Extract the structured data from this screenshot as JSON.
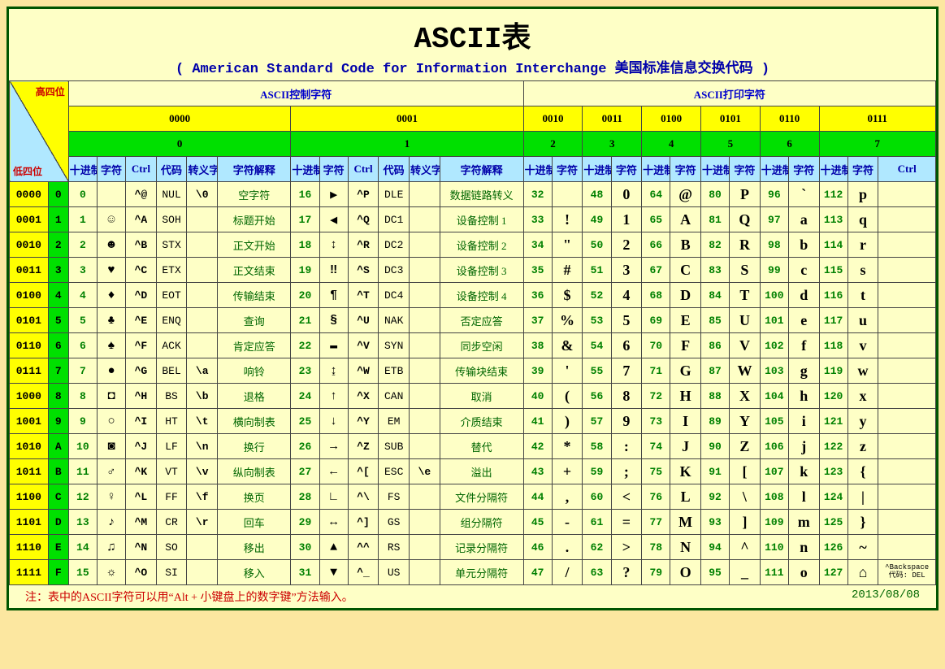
{
  "title": "ASCII表",
  "subtitle": "( American Standard Code for Information Interchange  美国标准信息交换代码 )",
  "diag": {
    "top": "高四位",
    "bottom": "低四位"
  },
  "section_headers": {
    "control": "ASCII控制字符",
    "print": "ASCII打印字符"
  },
  "high_bits": [
    "0000",
    "0001",
    "0010",
    "0011",
    "0100",
    "0101",
    "0110",
    "0111"
  ],
  "high_digits": [
    "0",
    "1",
    "2",
    "3",
    "4",
    "5",
    "6",
    "7"
  ],
  "col_labels": {
    "dec": "十进制",
    "char": "字符",
    "ctrl": "Ctrl",
    "code": "代码",
    "esc": "转义字符",
    "desc": "字符解释"
  },
  "low_bits": [
    "0000",
    "0001",
    "0010",
    "0011",
    "0100",
    "0101",
    "0110",
    "0111",
    "1000",
    "1001",
    "1010",
    "1011",
    "1100",
    "1101",
    "1110",
    "1111"
  ],
  "low_digits": [
    "0",
    "1",
    "2",
    "3",
    "4",
    "5",
    "6",
    "7",
    "8",
    "9",
    "A",
    "B",
    "C",
    "D",
    "E",
    "F"
  ],
  "rows": [
    {
      "b0": {
        "dec": "0",
        "sym": "",
        "ctrl": "^@",
        "code": "NUL",
        "esc": "\\0",
        "desc": "空字符"
      },
      "b1": {
        "dec": "16",
        "sym": "▶",
        "ctrl": "^P",
        "code": "DLE",
        "esc": "",
        "desc": "数据链路转义"
      },
      "p": [
        {
          "dec": "32",
          "ch": " "
        },
        {
          "dec": "48",
          "ch": "0"
        },
        {
          "dec": "64",
          "ch": "@"
        },
        {
          "dec": "80",
          "ch": "P"
        },
        {
          "dec": "96",
          "ch": "`"
        },
        {
          "dec": "112",
          "ch": "p"
        }
      ],
      "ctrl": ""
    },
    {
      "b0": {
        "dec": "1",
        "sym": "☺",
        "ctrl": "^A",
        "code": "SOH",
        "esc": "",
        "desc": "标题开始"
      },
      "b1": {
        "dec": "17",
        "sym": "◀",
        "ctrl": "^Q",
        "code": "DC1",
        "esc": "",
        "desc": "设备控制 1"
      },
      "p": [
        {
          "dec": "33",
          "ch": "!"
        },
        {
          "dec": "49",
          "ch": "1"
        },
        {
          "dec": "65",
          "ch": "A"
        },
        {
          "dec": "81",
          "ch": "Q"
        },
        {
          "dec": "97",
          "ch": "a"
        },
        {
          "dec": "113",
          "ch": "q"
        }
      ],
      "ctrl": ""
    },
    {
      "b0": {
        "dec": "2",
        "sym": "☻",
        "ctrl": "^B",
        "code": "STX",
        "esc": "",
        "desc": "正文开始"
      },
      "b1": {
        "dec": "18",
        "sym": "↕",
        "ctrl": "^R",
        "code": "DC2",
        "esc": "",
        "desc": "设备控制 2"
      },
      "p": [
        {
          "dec": "34",
          "ch": "\""
        },
        {
          "dec": "50",
          "ch": "2"
        },
        {
          "dec": "66",
          "ch": "B"
        },
        {
          "dec": "82",
          "ch": "R"
        },
        {
          "dec": "98",
          "ch": "b"
        },
        {
          "dec": "114",
          "ch": "r"
        }
      ],
      "ctrl": ""
    },
    {
      "b0": {
        "dec": "3",
        "sym": "♥",
        "ctrl": "^C",
        "code": "ETX",
        "esc": "",
        "desc": "正文结束"
      },
      "b1": {
        "dec": "19",
        "sym": "‼",
        "ctrl": "^S",
        "code": "DC3",
        "esc": "",
        "desc": "设备控制 3"
      },
      "p": [
        {
          "dec": "35",
          "ch": "#"
        },
        {
          "dec": "51",
          "ch": "3"
        },
        {
          "dec": "67",
          "ch": "C"
        },
        {
          "dec": "83",
          "ch": "S"
        },
        {
          "dec": "99",
          "ch": "c"
        },
        {
          "dec": "115",
          "ch": "s"
        }
      ],
      "ctrl": ""
    },
    {
      "b0": {
        "dec": "4",
        "sym": "♦",
        "ctrl": "^D",
        "code": "EOT",
        "esc": "",
        "desc": "传输结束"
      },
      "b1": {
        "dec": "20",
        "sym": "¶",
        "ctrl": "^T",
        "code": "DC4",
        "esc": "",
        "desc": "设备控制 4"
      },
      "p": [
        {
          "dec": "36",
          "ch": "$"
        },
        {
          "dec": "52",
          "ch": "4"
        },
        {
          "dec": "68",
          "ch": "D"
        },
        {
          "dec": "84",
          "ch": "T"
        },
        {
          "dec": "100",
          "ch": "d"
        },
        {
          "dec": "116",
          "ch": "t"
        }
      ],
      "ctrl": ""
    },
    {
      "b0": {
        "dec": "5",
        "sym": "♣",
        "ctrl": "^E",
        "code": "ENQ",
        "esc": "",
        "desc": "查询"
      },
      "b1": {
        "dec": "21",
        "sym": "§",
        "ctrl": "^U",
        "code": "NAK",
        "esc": "",
        "desc": "否定应答"
      },
      "p": [
        {
          "dec": "37",
          "ch": "%"
        },
        {
          "dec": "53",
          "ch": "5"
        },
        {
          "dec": "69",
          "ch": "E"
        },
        {
          "dec": "85",
          "ch": "U"
        },
        {
          "dec": "101",
          "ch": "e"
        },
        {
          "dec": "117",
          "ch": "u"
        }
      ],
      "ctrl": ""
    },
    {
      "b0": {
        "dec": "6",
        "sym": "♠",
        "ctrl": "^F",
        "code": "ACK",
        "esc": "",
        "desc": "肯定应答"
      },
      "b1": {
        "dec": "22",
        "sym": "▬",
        "ctrl": "^V",
        "code": "SYN",
        "esc": "",
        "desc": "同步空闲"
      },
      "p": [
        {
          "dec": "38",
          "ch": "&"
        },
        {
          "dec": "54",
          "ch": "6"
        },
        {
          "dec": "70",
          "ch": "F"
        },
        {
          "dec": "86",
          "ch": "V"
        },
        {
          "dec": "102",
          "ch": "f"
        },
        {
          "dec": "118",
          "ch": "v"
        }
      ],
      "ctrl": ""
    },
    {
      "b0": {
        "dec": "7",
        "sym": "●",
        "ctrl": "^G",
        "code": "BEL",
        "esc": "\\a",
        "desc": "响铃"
      },
      "b1": {
        "dec": "23",
        "sym": "↨",
        "ctrl": "^W",
        "code": "ETB",
        "esc": "",
        "desc": "传输块结束"
      },
      "p": [
        {
          "dec": "39",
          "ch": "'"
        },
        {
          "dec": "55",
          "ch": "7"
        },
        {
          "dec": "71",
          "ch": "G"
        },
        {
          "dec": "87",
          "ch": "W"
        },
        {
          "dec": "103",
          "ch": "g"
        },
        {
          "dec": "119",
          "ch": "w"
        }
      ],
      "ctrl": ""
    },
    {
      "b0": {
        "dec": "8",
        "sym": "◘",
        "ctrl": "^H",
        "code": "BS",
        "esc": "\\b",
        "desc": "退格"
      },
      "b1": {
        "dec": "24",
        "sym": "↑",
        "ctrl": "^X",
        "code": "CAN",
        "esc": "",
        "desc": "取消"
      },
      "p": [
        {
          "dec": "40",
          "ch": "("
        },
        {
          "dec": "56",
          "ch": "8"
        },
        {
          "dec": "72",
          "ch": "H"
        },
        {
          "dec": "88",
          "ch": "X"
        },
        {
          "dec": "104",
          "ch": "h"
        },
        {
          "dec": "120",
          "ch": "x"
        }
      ],
      "ctrl": ""
    },
    {
      "b0": {
        "dec": "9",
        "sym": "○",
        "ctrl": "^I",
        "code": "HT",
        "esc": "\\t",
        "desc": "横向制表"
      },
      "b1": {
        "dec": "25",
        "sym": "↓",
        "ctrl": "^Y",
        "code": "EM",
        "esc": "",
        "desc": "介质结束"
      },
      "p": [
        {
          "dec": "41",
          "ch": ")"
        },
        {
          "dec": "57",
          "ch": "9"
        },
        {
          "dec": "73",
          "ch": "I"
        },
        {
          "dec": "89",
          "ch": "Y"
        },
        {
          "dec": "105",
          "ch": "i"
        },
        {
          "dec": "121",
          "ch": "y"
        }
      ],
      "ctrl": ""
    },
    {
      "b0": {
        "dec": "10",
        "sym": "◙",
        "ctrl": "^J",
        "code": "LF",
        "esc": "\\n",
        "desc": "换行"
      },
      "b1": {
        "dec": "26",
        "sym": "→",
        "ctrl": "^Z",
        "code": "SUB",
        "esc": "",
        "desc": "替代"
      },
      "p": [
        {
          "dec": "42",
          "ch": "*"
        },
        {
          "dec": "58",
          "ch": ":"
        },
        {
          "dec": "74",
          "ch": "J"
        },
        {
          "dec": "90",
          "ch": "Z"
        },
        {
          "dec": "106",
          "ch": "j"
        },
        {
          "dec": "122",
          "ch": "z"
        }
      ],
      "ctrl": ""
    },
    {
      "b0": {
        "dec": "11",
        "sym": "♂",
        "ctrl": "^K",
        "code": "VT",
        "esc": "\\v",
        "desc": "纵向制表"
      },
      "b1": {
        "dec": "27",
        "sym": "←",
        "ctrl": "^[",
        "code": "ESC",
        "esc": "\\e",
        "desc": "溢出"
      },
      "p": [
        {
          "dec": "43",
          "ch": "+"
        },
        {
          "dec": "59",
          "ch": ";"
        },
        {
          "dec": "75",
          "ch": "K"
        },
        {
          "dec": "91",
          "ch": "["
        },
        {
          "dec": "107",
          "ch": "k"
        },
        {
          "dec": "123",
          "ch": "{"
        }
      ],
      "ctrl": ""
    },
    {
      "b0": {
        "dec": "12",
        "sym": "♀",
        "ctrl": "^L",
        "code": "FF",
        "esc": "\\f",
        "desc": "换页"
      },
      "b1": {
        "dec": "28",
        "sym": "∟",
        "ctrl": "^\\",
        "code": "FS",
        "esc": "",
        "desc": "文件分隔符"
      },
      "p": [
        {
          "dec": "44",
          "ch": ","
        },
        {
          "dec": "60",
          "ch": "<"
        },
        {
          "dec": "76",
          "ch": "L"
        },
        {
          "dec": "92",
          "ch": "\\"
        },
        {
          "dec": "108",
          "ch": "l"
        },
        {
          "dec": "124",
          "ch": "|"
        }
      ],
      "ctrl": ""
    },
    {
      "b0": {
        "dec": "13",
        "sym": "♪",
        "ctrl": "^M",
        "code": "CR",
        "esc": "\\r",
        "desc": "回车"
      },
      "b1": {
        "dec": "29",
        "sym": "↔",
        "ctrl": "^]",
        "code": "GS",
        "esc": "",
        "desc": "组分隔符"
      },
      "p": [
        {
          "dec": "45",
          "ch": "-"
        },
        {
          "dec": "61",
          "ch": "="
        },
        {
          "dec": "77",
          "ch": "M"
        },
        {
          "dec": "93",
          "ch": "]"
        },
        {
          "dec": "109",
          "ch": "m"
        },
        {
          "dec": "125",
          "ch": "}"
        }
      ],
      "ctrl": ""
    },
    {
      "b0": {
        "dec": "14",
        "sym": "♫",
        "ctrl": "^N",
        "code": "SO",
        "esc": "",
        "desc": "移出"
      },
      "b1": {
        "dec": "30",
        "sym": "▲",
        "ctrl": "^^",
        "code": "RS",
        "esc": "",
        "desc": "记录分隔符"
      },
      "p": [
        {
          "dec": "46",
          "ch": "."
        },
        {
          "dec": "62",
          "ch": ">"
        },
        {
          "dec": "78",
          "ch": "N"
        },
        {
          "dec": "94",
          "ch": "^"
        },
        {
          "dec": "110",
          "ch": "n"
        },
        {
          "dec": "126",
          "ch": "~"
        }
      ],
      "ctrl": ""
    },
    {
      "b0": {
        "dec": "15",
        "sym": "☼",
        "ctrl": "^O",
        "code": "SI",
        "esc": "",
        "desc": "移入"
      },
      "b1": {
        "dec": "31",
        "sym": "▼",
        "ctrl": "^_",
        "code": "US",
        "esc": "",
        "desc": "单元分隔符"
      },
      "p": [
        {
          "dec": "47",
          "ch": "/"
        },
        {
          "dec": "63",
          "ch": "?"
        },
        {
          "dec": "79",
          "ch": "O"
        },
        {
          "dec": "95",
          "ch": "_"
        },
        {
          "dec": "111",
          "ch": "o"
        },
        {
          "dec": "127",
          "ch": "⌂"
        }
      ],
      "ctrl": "^Backspace 代码: DEL"
    }
  ],
  "footer": {
    "note": "注：表中的ASCII字符可以用“Alt + 小键盘上的数字键”方法输入。",
    "date": "2013/08/08"
  }
}
